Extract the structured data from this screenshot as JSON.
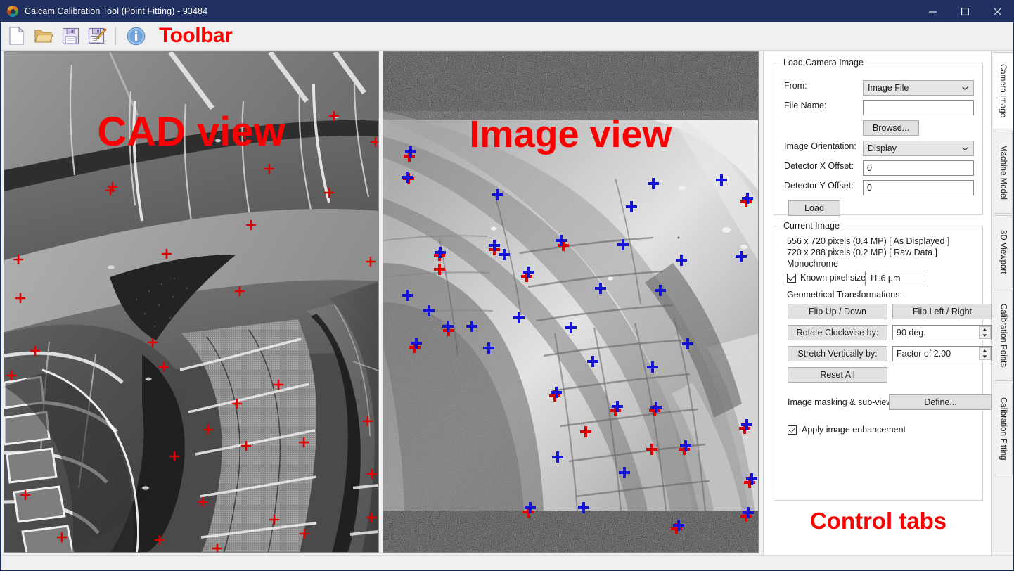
{
  "window": {
    "title": "Calcam Calibration Tool (Point Fitting) - 93484",
    "logo_icon": "calcam-logo-icon",
    "minimize_label": "—",
    "maximize_label": "☐",
    "close_label": "✕"
  },
  "toolbar": {
    "annotation": "Toolbar",
    "buttons": [
      {
        "name": "new-file-button",
        "icon": "new-document-icon",
        "tooltip": "New"
      },
      {
        "name": "open-file-button",
        "icon": "open-folder-icon",
        "tooltip": "Open"
      },
      {
        "name": "save-button",
        "icon": "floppy-disk-icon",
        "tooltip": "Save"
      },
      {
        "name": "save-as-button",
        "icon": "floppy-disk-pencil-icon",
        "tooltip": "Save As"
      },
      {
        "name": "info-button",
        "icon": "info-circle-icon",
        "tooltip": "About"
      }
    ]
  },
  "cad_view": {
    "annotation": "CAD view"
  },
  "image_view": {
    "annotation": "Image view"
  },
  "control_panel": {
    "annotation": "Control tabs",
    "load_group": {
      "title": "Load Camera Image",
      "from_label": "From:",
      "from_value": "Image File",
      "file_name_label": "File Name:",
      "file_name_value": "",
      "file_name_placeholder": "",
      "browse_label": "Browse...",
      "orientation_label": "Image Orientation:",
      "orientation_value": "Display",
      "detector_x_label": "Detector X Offset:",
      "detector_x_value": "0",
      "detector_y_label": "Detector Y Offset:",
      "detector_y_value": "0",
      "load_label": "Load"
    },
    "current_group": {
      "title": "Current Image",
      "info_line_1": "556 x 720 pixels (0.4 MP) [ As Displayed ]",
      "info_line_2": "720 x 288 pixels (0.2 MP) [ Raw Data ]",
      "info_line_3": "Monochrome",
      "known_pixel_label": "Known pixel size:",
      "known_pixel_checked": true,
      "known_pixel_value": "11.6 µm",
      "transforms_label": "Geometrical Transformations:",
      "flip_ud_label": "Flip Up / Down",
      "flip_lr_label": "Flip Left / Right",
      "rotate_label": "Rotate Clockwise by:",
      "rotate_value": "90 deg.",
      "stretch_label": "Stretch Vertically by:",
      "stretch_value": "Factor of 2.00",
      "reset_label": "Reset All",
      "masking_label": "Image masking & sub-views:",
      "define_label": "Define...",
      "enhancement_label": "Apply image enhancement",
      "enhancement_checked": true
    }
  },
  "tabs": [
    {
      "label": "Camera Image",
      "active": true
    },
    {
      "label": "Machine Model",
      "active": false
    },
    {
      "label": "3D Viewport",
      "active": false
    },
    {
      "label": "Calibration Points",
      "active": false
    },
    {
      "label": "Calibration Fitting",
      "active": false
    }
  ],
  "colors": {
    "titlebar": "#1f3061",
    "annotation_red": "#fb0000",
    "cad_marker": "#e00000",
    "image_marker_blue": "#1414d2",
    "image_marker_red": "#e00000",
    "accent": "#0078d7"
  },
  "status_bar": {
    "text": ""
  }
}
